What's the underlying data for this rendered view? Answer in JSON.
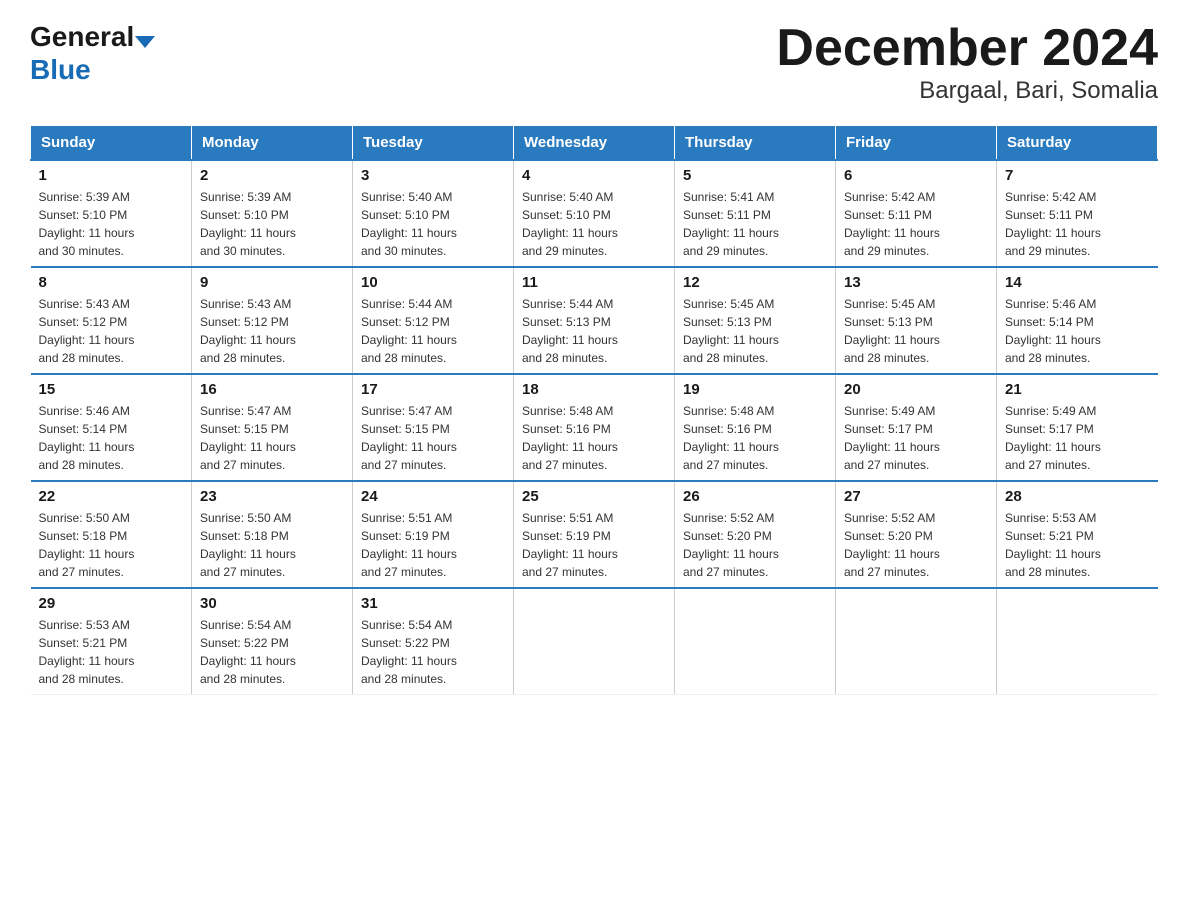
{
  "header": {
    "logo_general": "General",
    "logo_blue": "Blue",
    "title": "December 2024",
    "subtitle": "Bargaal, Bari, Somalia"
  },
  "calendar": {
    "days_of_week": [
      "Sunday",
      "Monday",
      "Tuesday",
      "Wednesday",
      "Thursday",
      "Friday",
      "Saturday"
    ],
    "weeks": [
      [
        {
          "day": "1",
          "sunrise": "5:39 AM",
          "sunset": "5:10 PM",
          "daylight": "11 hours and 30 minutes."
        },
        {
          "day": "2",
          "sunrise": "5:39 AM",
          "sunset": "5:10 PM",
          "daylight": "11 hours and 30 minutes."
        },
        {
          "day": "3",
          "sunrise": "5:40 AM",
          "sunset": "5:10 PM",
          "daylight": "11 hours and 30 minutes."
        },
        {
          "day": "4",
          "sunrise": "5:40 AM",
          "sunset": "5:10 PM",
          "daylight": "11 hours and 29 minutes."
        },
        {
          "day": "5",
          "sunrise": "5:41 AM",
          "sunset": "5:11 PM",
          "daylight": "11 hours and 29 minutes."
        },
        {
          "day": "6",
          "sunrise": "5:42 AM",
          "sunset": "5:11 PM",
          "daylight": "11 hours and 29 minutes."
        },
        {
          "day": "7",
          "sunrise": "5:42 AM",
          "sunset": "5:11 PM",
          "daylight": "11 hours and 29 minutes."
        }
      ],
      [
        {
          "day": "8",
          "sunrise": "5:43 AM",
          "sunset": "5:12 PM",
          "daylight": "11 hours and 28 minutes."
        },
        {
          "day": "9",
          "sunrise": "5:43 AM",
          "sunset": "5:12 PM",
          "daylight": "11 hours and 28 minutes."
        },
        {
          "day": "10",
          "sunrise": "5:44 AM",
          "sunset": "5:12 PM",
          "daylight": "11 hours and 28 minutes."
        },
        {
          "day": "11",
          "sunrise": "5:44 AM",
          "sunset": "5:13 PM",
          "daylight": "11 hours and 28 minutes."
        },
        {
          "day": "12",
          "sunrise": "5:45 AM",
          "sunset": "5:13 PM",
          "daylight": "11 hours and 28 minutes."
        },
        {
          "day": "13",
          "sunrise": "5:45 AM",
          "sunset": "5:13 PM",
          "daylight": "11 hours and 28 minutes."
        },
        {
          "day": "14",
          "sunrise": "5:46 AM",
          "sunset": "5:14 PM",
          "daylight": "11 hours and 28 minutes."
        }
      ],
      [
        {
          "day": "15",
          "sunrise": "5:46 AM",
          "sunset": "5:14 PM",
          "daylight": "11 hours and 28 minutes."
        },
        {
          "day": "16",
          "sunrise": "5:47 AM",
          "sunset": "5:15 PM",
          "daylight": "11 hours and 27 minutes."
        },
        {
          "day": "17",
          "sunrise": "5:47 AM",
          "sunset": "5:15 PM",
          "daylight": "11 hours and 27 minutes."
        },
        {
          "day": "18",
          "sunrise": "5:48 AM",
          "sunset": "5:16 PM",
          "daylight": "11 hours and 27 minutes."
        },
        {
          "day": "19",
          "sunrise": "5:48 AM",
          "sunset": "5:16 PM",
          "daylight": "11 hours and 27 minutes."
        },
        {
          "day": "20",
          "sunrise": "5:49 AM",
          "sunset": "5:17 PM",
          "daylight": "11 hours and 27 minutes."
        },
        {
          "day": "21",
          "sunrise": "5:49 AM",
          "sunset": "5:17 PM",
          "daylight": "11 hours and 27 minutes."
        }
      ],
      [
        {
          "day": "22",
          "sunrise": "5:50 AM",
          "sunset": "5:18 PM",
          "daylight": "11 hours and 27 minutes."
        },
        {
          "day": "23",
          "sunrise": "5:50 AM",
          "sunset": "5:18 PM",
          "daylight": "11 hours and 27 minutes."
        },
        {
          "day": "24",
          "sunrise": "5:51 AM",
          "sunset": "5:19 PM",
          "daylight": "11 hours and 27 minutes."
        },
        {
          "day": "25",
          "sunrise": "5:51 AM",
          "sunset": "5:19 PM",
          "daylight": "11 hours and 27 minutes."
        },
        {
          "day": "26",
          "sunrise": "5:52 AM",
          "sunset": "5:20 PM",
          "daylight": "11 hours and 27 minutes."
        },
        {
          "day": "27",
          "sunrise": "5:52 AM",
          "sunset": "5:20 PM",
          "daylight": "11 hours and 27 minutes."
        },
        {
          "day": "28",
          "sunrise": "5:53 AM",
          "sunset": "5:21 PM",
          "daylight": "11 hours and 28 minutes."
        }
      ],
      [
        {
          "day": "29",
          "sunrise": "5:53 AM",
          "sunset": "5:21 PM",
          "daylight": "11 hours and 28 minutes."
        },
        {
          "day": "30",
          "sunrise": "5:54 AM",
          "sunset": "5:22 PM",
          "daylight": "11 hours and 28 minutes."
        },
        {
          "day": "31",
          "sunrise": "5:54 AM",
          "sunset": "5:22 PM",
          "daylight": "11 hours and 28 minutes."
        },
        null,
        null,
        null,
        null
      ]
    ]
  }
}
